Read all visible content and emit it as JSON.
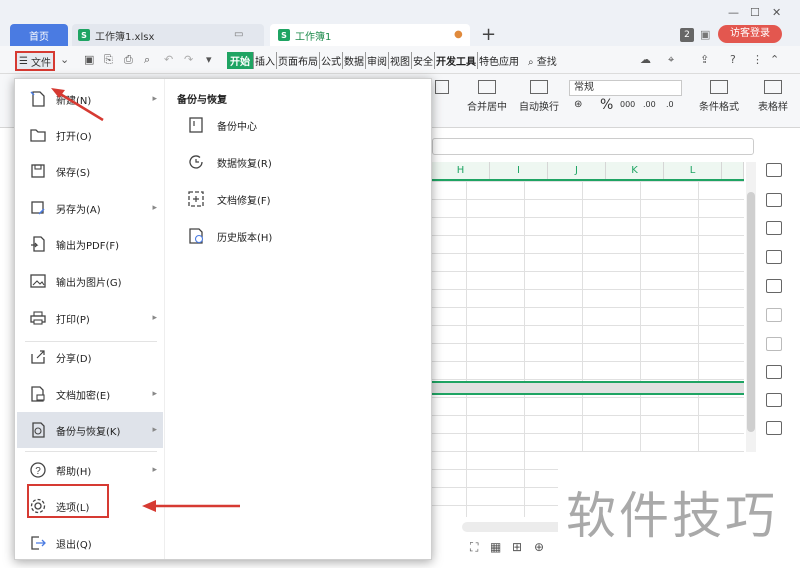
{
  "tabs": {
    "home": "首页",
    "file1": "工作簿1.xlsx",
    "file2": "工作簿1",
    "new_tab_symbol": "+"
  },
  "header": {
    "badge": "2",
    "login": "访客登录"
  },
  "menubar": {
    "file_label": "文件",
    "tabs": [
      "开始",
      "插入",
      "页面布局",
      "公式",
      "数据",
      "审阅",
      "视图",
      "安全",
      "开发工具",
      "特色应用"
    ],
    "search": "查找"
  },
  "ribbon": {
    "merge": "合并居中",
    "wrap": "自动换行",
    "number_format": "常规",
    "percent": "%",
    "cond_format": "条件格式",
    "table_style": "表格样"
  },
  "grid": {
    "columns": [
      "H",
      "I",
      "J",
      "K",
      "L"
    ]
  },
  "file_menu": {
    "items": [
      {
        "label": "新建(N)",
        "icon": "new-file-icon",
        "has_sub": true
      },
      {
        "label": "打开(O)",
        "icon": "folder-open-icon",
        "has_sub": false
      },
      {
        "label": "保存(S)",
        "icon": "save-icon",
        "has_sub": false
      },
      {
        "label": "另存为(A)",
        "icon": "save-as-icon",
        "has_sub": true
      },
      {
        "label": "输出为PDF(F)",
        "icon": "pdf-export-icon",
        "has_sub": false
      },
      {
        "label": "输出为图片(G)",
        "icon": "image-export-icon",
        "has_sub": false
      },
      {
        "label": "打印(P)",
        "icon": "print-icon",
        "has_sub": true
      },
      {
        "label": "分享(D)",
        "icon": "share-icon",
        "has_sub": false
      },
      {
        "label": "文档加密(E)",
        "icon": "lock-doc-icon",
        "has_sub": true
      },
      {
        "label": "备份与恢复(K)",
        "icon": "backup-icon",
        "has_sub": true
      },
      {
        "label": "帮助(H)",
        "icon": "help-icon",
        "has_sub": true
      },
      {
        "label": "选项(L)",
        "icon": "gear-icon",
        "has_sub": false
      },
      {
        "label": "退出(Q)",
        "icon": "exit-icon",
        "has_sub": false
      }
    ],
    "submenu_title": "备份与恢复",
    "submenu": [
      {
        "label": "备份中心",
        "icon": "backup-center-icon"
      },
      {
        "label": "数据恢复(R)",
        "icon": "data-recovery-icon"
      },
      {
        "label": "文档修复(F)",
        "icon": "doc-repair-icon"
      },
      {
        "label": "历史版本(H)",
        "icon": "history-icon"
      }
    ]
  },
  "watermark": "软件技巧",
  "colors": {
    "accent_green": "#1fa463",
    "tab_blue": "#4a7be2",
    "highlight_red": "#d63a32",
    "login_red": "#e3574f"
  }
}
